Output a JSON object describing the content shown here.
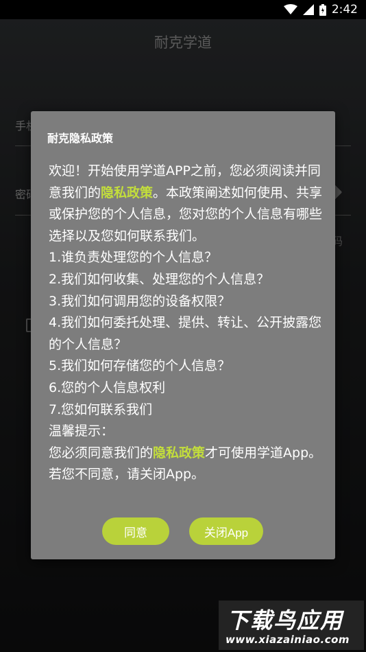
{
  "status_bar": {
    "time": "2:42",
    "icons": [
      "wifi-icon",
      "signal-icon",
      "battery-icon"
    ]
  },
  "app": {
    "title": "耐克学道",
    "phone_label_fragment": "手机",
    "password_label_fragment": "密码",
    "forgot_fragment": "码"
  },
  "dialog": {
    "title": "耐克隐私政策",
    "intro_before": "欢迎！开始使用学道APP之前，您必须阅读并同意我们的",
    "intro_link": "隐私政策",
    "intro_after": "。本政策阐述如何使用、共享或保护您的个人信息，您对您的个人信息有哪些选择以及您如何联系我们。",
    "items": [
      "1.谁负责处理您的个人信息？",
      "2.我们如何收集、处理您的个人信息？",
      "3.我们如何调用您的设备权限？",
      "4.我们如何委托处理、提供、转让、公开披露您的个人信息？",
      "5.我们如何存储您的个人信息？",
      "6.您的个人信息权利",
      "7.您如何联系我们"
    ],
    "tip_label": "温馨提示：",
    "tip_before": "您必须同意我们的",
    "tip_link": "隐私政策",
    "tip_after": "才可使用学道App。若您不同意，请关闭App。",
    "agree_label": "同意",
    "close_label": "关闭App"
  },
  "watermark": {
    "line1": "下载鸟应用",
    "line2": "www.xiazainiao.com"
  },
  "colors": {
    "accent": "#b9d23a",
    "highlight_text": "#c3de3b",
    "dialog_bg": "#7d7d7d"
  }
}
